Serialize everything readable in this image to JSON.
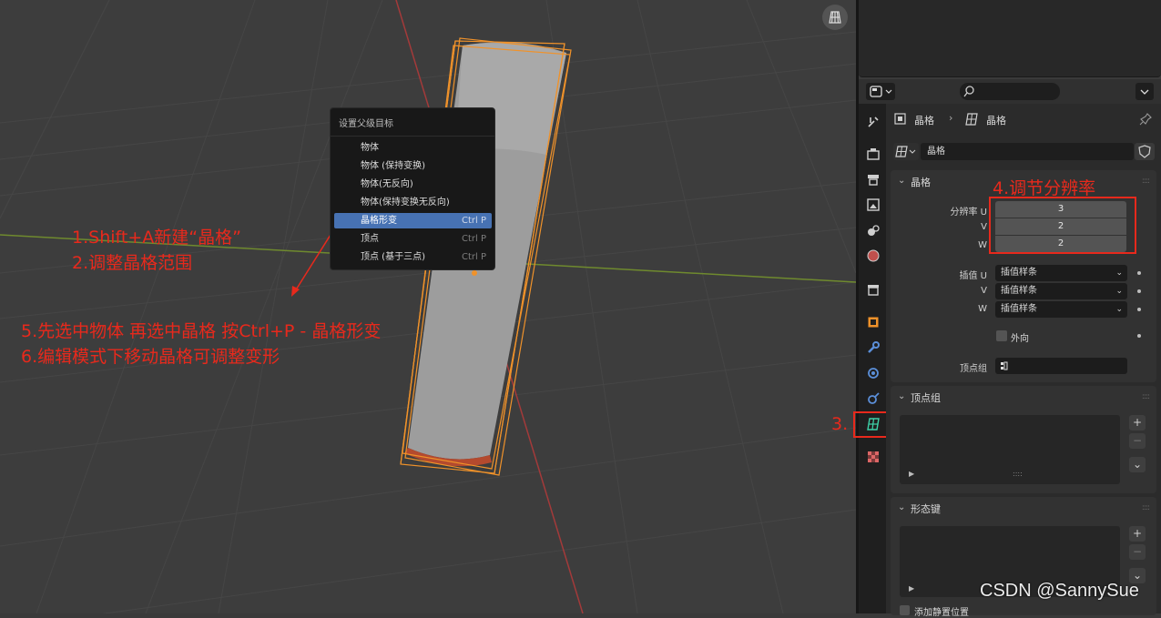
{
  "context_menu": {
    "title": "设置父级目标",
    "items": [
      {
        "label": "物体",
        "shortcut": ""
      },
      {
        "label": "物体 (保持变换)",
        "shortcut": ""
      },
      {
        "label": "物体(无反向)",
        "shortcut": ""
      },
      {
        "label": "物体(保持变换无反向)",
        "shortcut": ""
      },
      {
        "label": "晶格形变",
        "shortcut": "Ctrl P",
        "active": true
      },
      {
        "label": "顶点",
        "shortcut": "Ctrl P"
      },
      {
        "label": "顶点 (基于三点)",
        "shortcut": "Ctrl P"
      }
    ]
  },
  "annotations": {
    "step1": "1.Shift+A新建“晶格”",
    "step2": "2.调整晶格范围",
    "step3": "3.",
    "step4": "4.调节分辨率",
    "step5": "5.先选中物体 再选中晶格 按Ctrl+P - 晶格形变",
    "step6": "6.编辑模式下移动晶格可调整变形"
  },
  "properties": {
    "breadcrumb": {
      "object": "晶格",
      "data": "晶格"
    },
    "datablock_name": "晶格",
    "lattice_panel": {
      "title": "晶格",
      "resolution_u_label": "分辨率 U",
      "resolution_v_label": "V",
      "resolution_w_label": "W",
      "resolution_u": "3",
      "resolution_v": "2",
      "resolution_w": "2",
      "interp_u_label": "插值 U",
      "interp_v_label": "V",
      "interp_w_label": "W",
      "interp_u": "插值样条",
      "interp_v": "插值样条",
      "interp_w": "插值样条",
      "outside_label": "外向",
      "vertex_group_label": "顶点组"
    },
    "vertex_groups_panel": {
      "title": "顶点组"
    },
    "shape_keys_panel": {
      "title": "形态键",
      "relative_label": "添加静置位置"
    }
  },
  "watermark": "CSDN @SannySue",
  "colors": {
    "accent_blue": "#4772b3",
    "annotation_red": "#e8291c",
    "selection_orange": "#f0922a",
    "lattice_tab_green": "#3ed1a8"
  }
}
